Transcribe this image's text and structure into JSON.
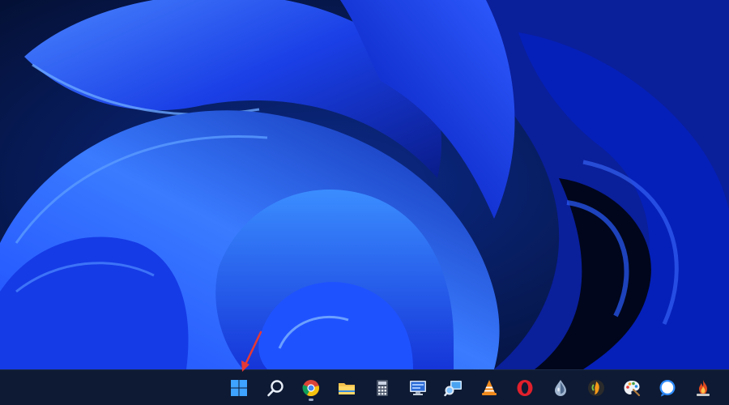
{
  "desktop": {
    "wallpaper": "windows-11-bloom-wallpaper",
    "colors": {
      "deep": "#06143a",
      "mid": "#1338e8",
      "bright": "#2f6bff",
      "highlight": "#5aa8ff"
    }
  },
  "taskbar": {
    "background": "#0e1a33",
    "items": [
      {
        "id": "start",
        "icon": "windows-start-icon",
        "color": "#3ea2ff"
      },
      {
        "id": "search",
        "icon": "search-icon",
        "color": "#e8eef8"
      },
      {
        "id": "chrome",
        "icon": "chrome-icon",
        "running": true
      },
      {
        "id": "explorer",
        "icon": "file-explorer-icon",
        "color": "#f2c14e"
      },
      {
        "id": "calculator",
        "icon": "calculator-icon"
      },
      {
        "id": "remote",
        "icon": "remote-desktop-icon"
      },
      {
        "id": "magnifier",
        "icon": "magnifier-icon"
      },
      {
        "id": "vlc",
        "icon": "vlc-icon",
        "color": "#f18a1d"
      },
      {
        "id": "opera",
        "icon": "opera-icon",
        "color": "#e0202c"
      },
      {
        "id": "droplet",
        "icon": "droplet-icon"
      },
      {
        "id": "fl-studio",
        "icon": "fl-studio-icon",
        "color": "#f59a18"
      },
      {
        "id": "paint",
        "icon": "paint-palette-icon"
      },
      {
        "id": "messenger",
        "icon": "chat-bubble-icon",
        "color": "#2e8cff"
      },
      {
        "id": "game",
        "icon": "flame-game-icon",
        "color": "#e14a1f"
      }
    ]
  },
  "annotation": {
    "icon": "red-arrow-pointer",
    "color": "#e53935",
    "target": "start"
  }
}
